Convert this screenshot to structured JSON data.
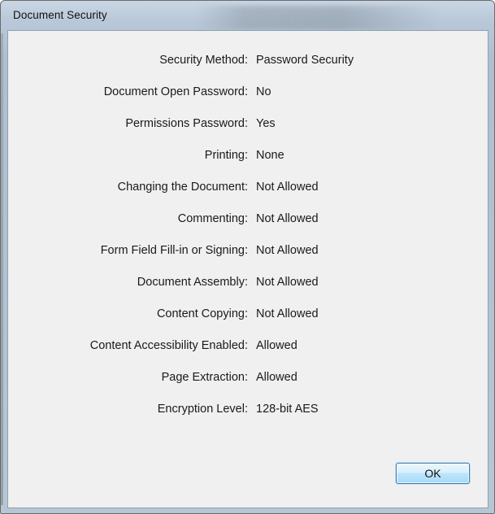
{
  "window": {
    "title": "Document Security"
  },
  "security_properties": [
    {
      "label": "Security Method:",
      "value": "Password Security"
    },
    {
      "label": "Document Open Password:",
      "value": "No"
    },
    {
      "label": "Permissions Password:",
      "value": "Yes"
    },
    {
      "label": "Printing:",
      "value": "None"
    },
    {
      "label": "Changing the Document:",
      "value": "Not Allowed"
    },
    {
      "label": "Commenting:",
      "value": "Not Allowed"
    },
    {
      "label": "Form Field Fill-in or Signing:",
      "value": "Not Allowed"
    },
    {
      "label": "Document Assembly:",
      "value": "Not Allowed"
    },
    {
      "label": "Content Copying:",
      "value": "Not Allowed"
    },
    {
      "label": "Content Accessibility Enabled:",
      "value": "Allowed"
    },
    {
      "label": "Page Extraction:",
      "value": "Allowed"
    },
    {
      "label": "Encryption Level:",
      "value": "128-bit AES"
    }
  ],
  "buttons": {
    "ok_label": "OK"
  },
  "colors": {
    "window_frame": "#b8c6d4",
    "client_background": "#f0f0f0",
    "button_border": "#3c7fb1"
  }
}
